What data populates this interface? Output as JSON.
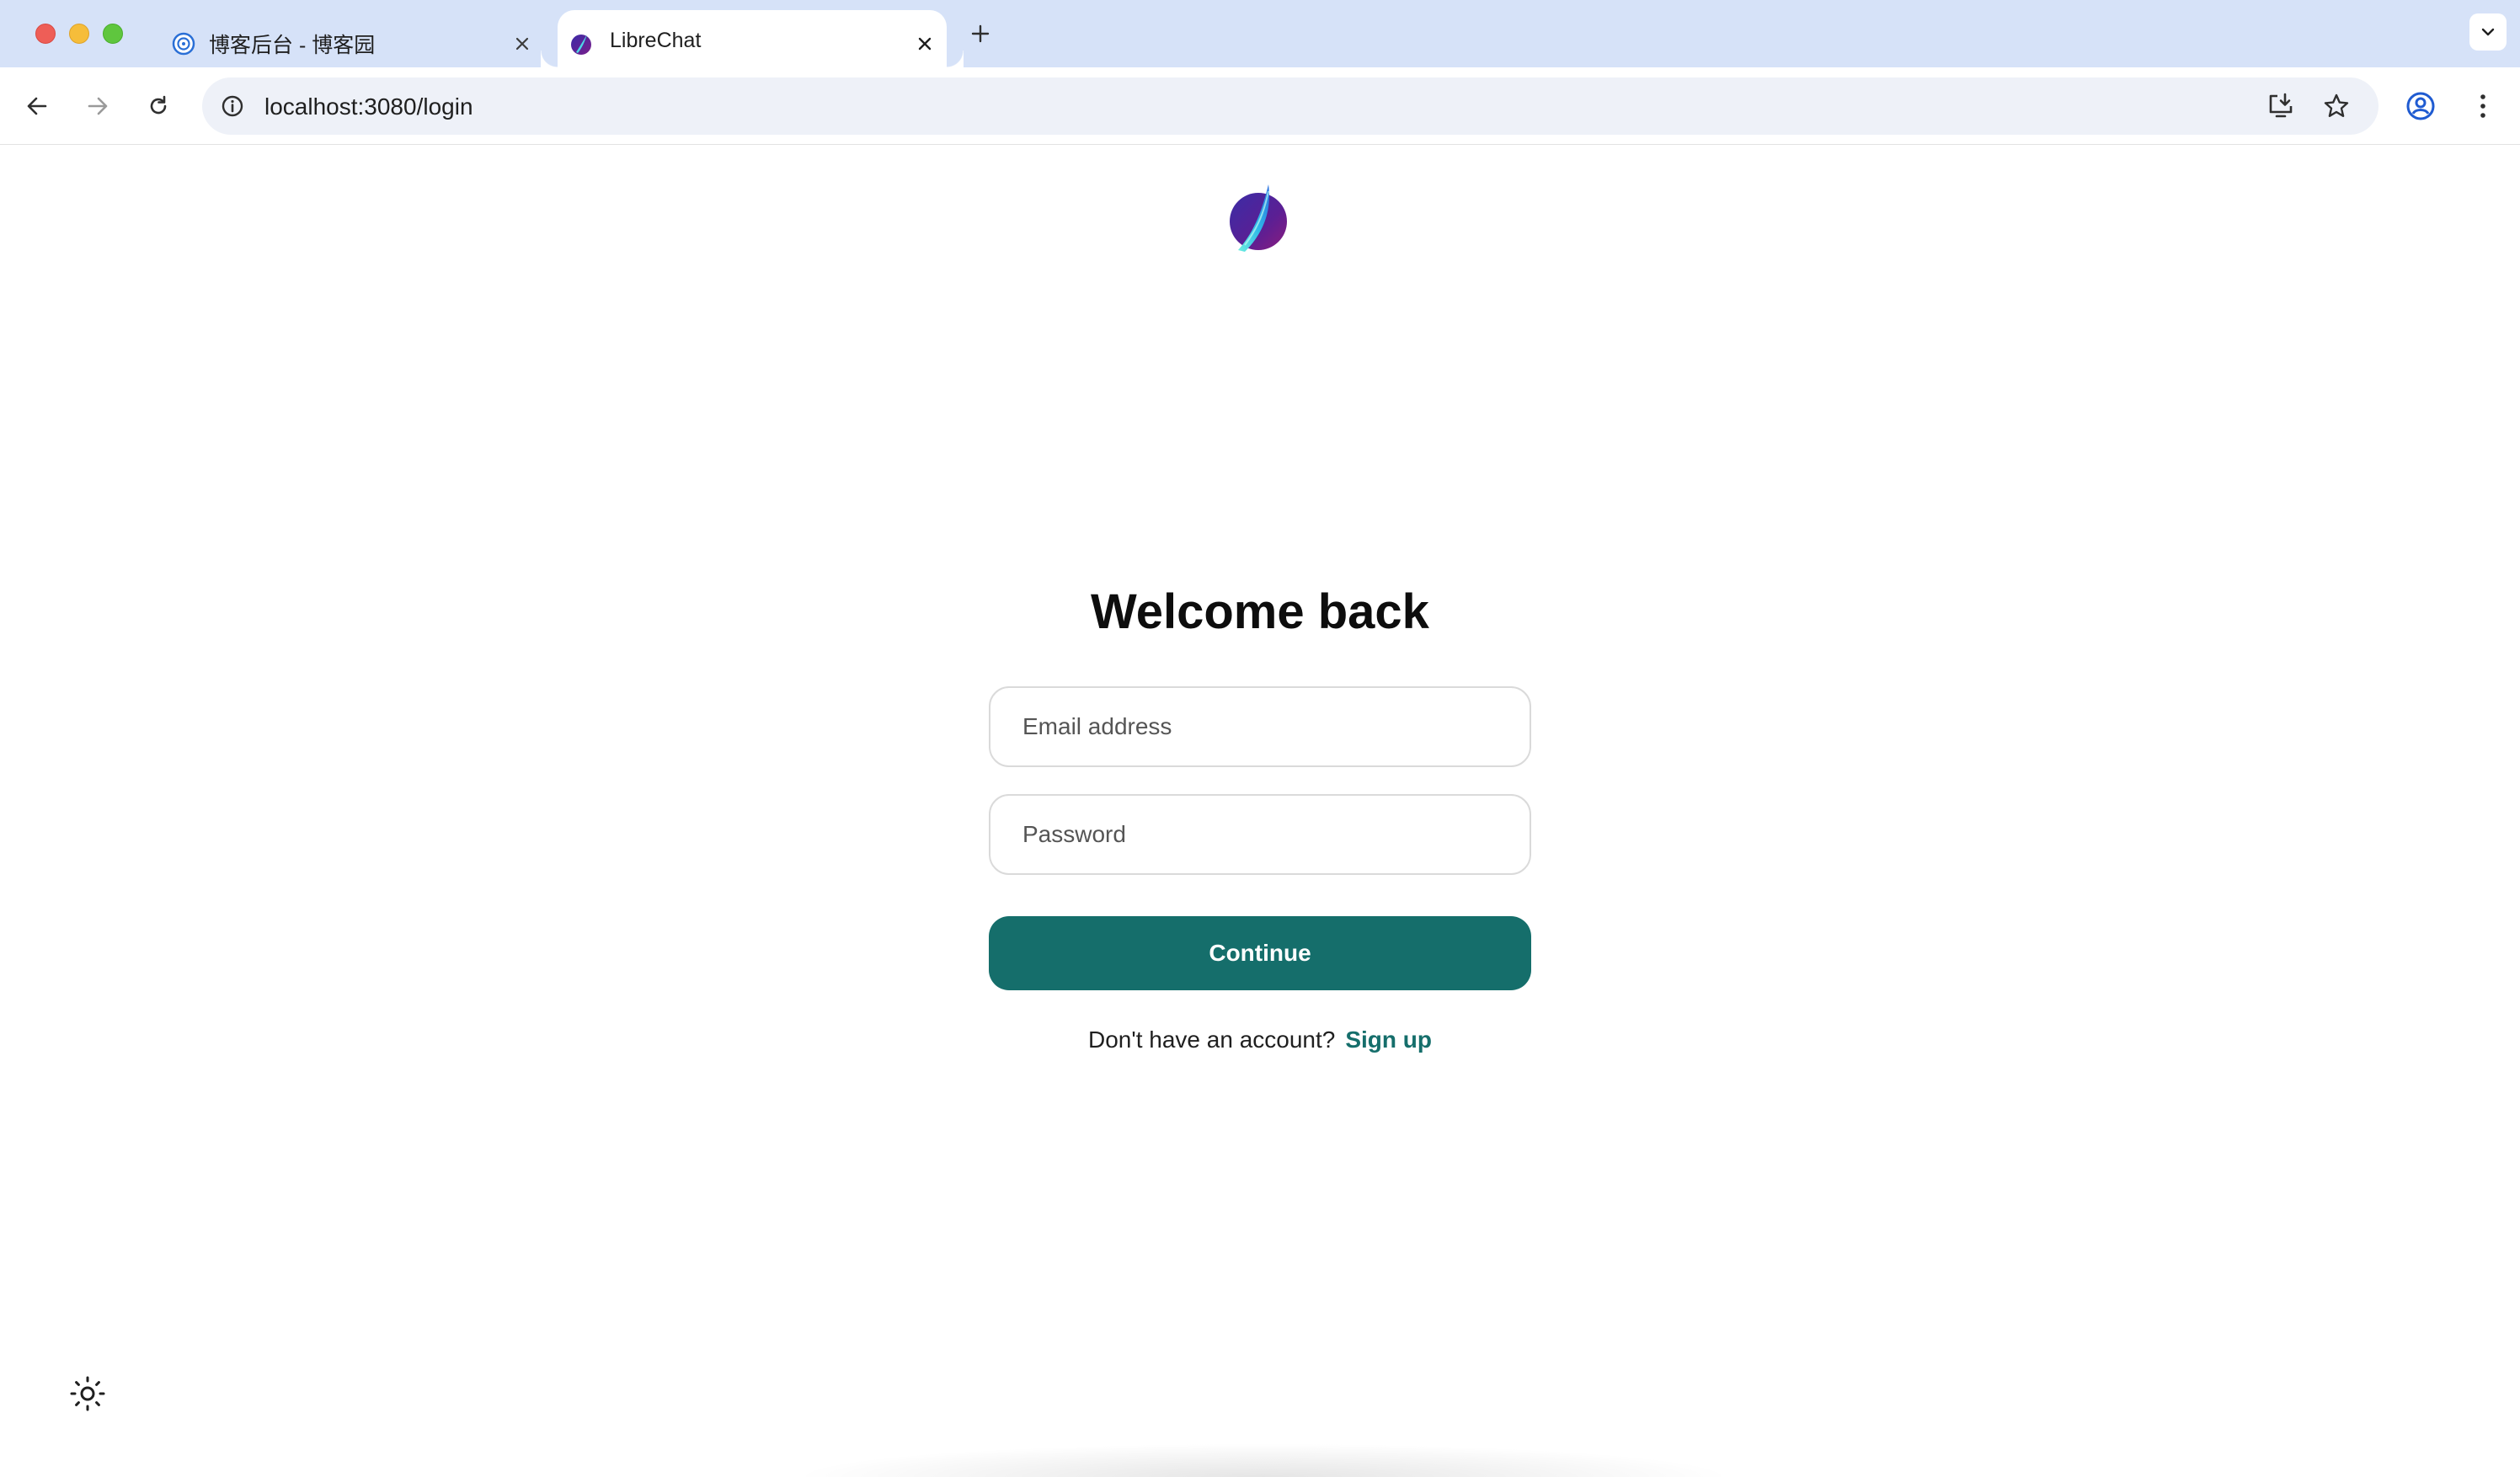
{
  "browser": {
    "tabs": [
      {
        "title": "博客后台 - 博客园",
        "icon": "cnblogs-favicon",
        "active": false
      },
      {
        "title": "LibreChat",
        "icon": "librechat-favicon",
        "active": true
      }
    ],
    "address_bar": {
      "url": "localhost:3080/login"
    },
    "icons": {
      "back": "arrow-left-icon",
      "forward": "arrow-right-icon",
      "reload": "reload-icon",
      "site_info": "info-icon",
      "install": "install-app-icon",
      "bookmark": "star-icon",
      "profile": "profile-icon",
      "menu": "kebab-menu-icon",
      "new_tab": "plus-icon",
      "tab_search": "chevron-down-icon"
    }
  },
  "login": {
    "heading": "Welcome back",
    "email_placeholder": "Email address",
    "password_placeholder": "Password",
    "continue_label": "Continue",
    "no_account_text": "Don't have an account?",
    "signup_label": "Sign up"
  },
  "colors": {
    "accent": "#156e6b",
    "tabstrip": "#d6e2f8",
    "omnibox": "#eef1f8"
  }
}
